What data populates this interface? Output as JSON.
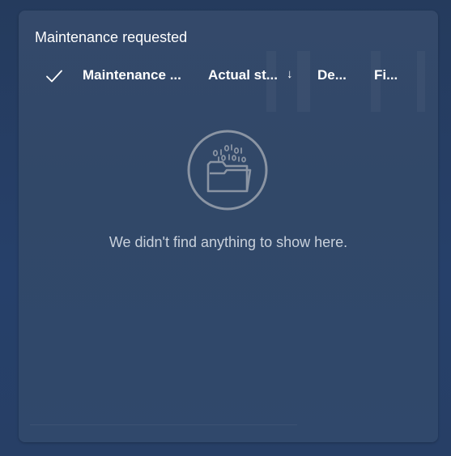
{
  "card": {
    "title": "Maintenance requested"
  },
  "columns": [
    {
      "label": "Maintenance ..."
    },
    {
      "label": "Actual st..."
    },
    {
      "label": "De..."
    },
    {
      "label": "Fi..."
    }
  ],
  "sort": {
    "arrow": "↓",
    "direction": "descending"
  },
  "empty_state": {
    "message": "We didn't find anything to show here.",
    "icon": "folder-binary-icon"
  },
  "icons": {
    "select_all": "check-icon"
  },
  "colors": {
    "card_background": "#324868",
    "text": "#ffffff",
    "muted_text": "#c9d1dc",
    "icon_stroke": "#8a94a3"
  }
}
